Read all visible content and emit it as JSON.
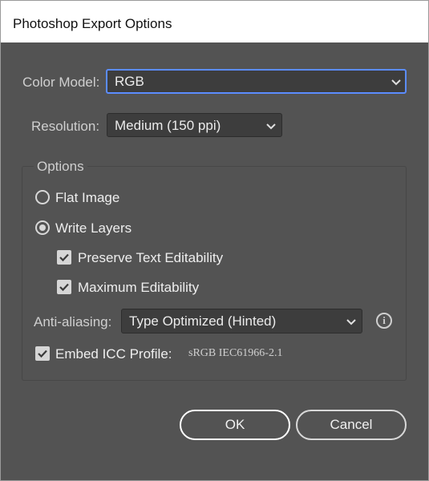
{
  "window": {
    "title": "Photoshop Export Options"
  },
  "color_model": {
    "label": "Color Model:",
    "value": "RGB"
  },
  "resolution": {
    "label": "Resolution:",
    "value": "Medium (150 ppi)"
  },
  "options": {
    "legend": "Options",
    "flat_image": {
      "label": "Flat Image",
      "selected": false
    },
    "write_layers": {
      "label": "Write Layers",
      "selected": true
    },
    "preserve_text": {
      "label": "Preserve Text Editability",
      "checked": true
    },
    "max_editability": {
      "label": "Maximum Editability",
      "checked": true
    },
    "anti_aliasing": {
      "label": "Anti-aliasing:",
      "value": "Type Optimized (Hinted)"
    },
    "info_glyph": "i",
    "embed_icc": {
      "label": "Embed ICC Profile:",
      "checked": true,
      "profile": "sRGB IEC61966-2.1"
    }
  },
  "buttons": {
    "ok": "OK",
    "cancel": "Cancel"
  },
  "colors": {
    "background": "#535353",
    "focus": "#5b8cff",
    "field": "#3d3d3d"
  }
}
